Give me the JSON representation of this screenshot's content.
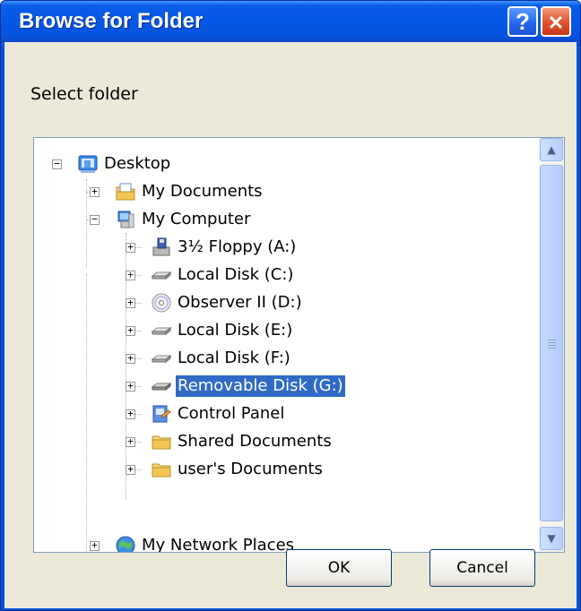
{
  "window": {
    "title": "Browse for Folder",
    "help_label": "?",
    "close_label": "✕"
  },
  "prompt": "Select folder",
  "tree": {
    "items": [
      {
        "label": "Desktop",
        "expander": "−",
        "icon": "desktop-icon"
      },
      {
        "label": "My Documents",
        "expander": "+",
        "icon": "my-documents-icon"
      },
      {
        "label": "My Computer",
        "expander": "−",
        "icon": "my-computer-icon"
      },
      {
        "label": "3½ Floppy (A:)",
        "expander": "+",
        "icon": "floppy-drive-icon"
      },
      {
        "label": "Local Disk (C:)",
        "expander": "+",
        "icon": "hard-disk-icon"
      },
      {
        "label": "Observer II (D:)",
        "expander": "+",
        "icon": "cd-drive-icon"
      },
      {
        "label": "Local Disk (E:)",
        "expander": "+",
        "icon": "hard-disk-icon"
      },
      {
        "label": "Local Disk (F:)",
        "expander": "+",
        "icon": "hard-disk-icon"
      },
      {
        "label": "Removable Disk (G:)",
        "expander": "+",
        "icon": "removable-disk-icon",
        "selected": true
      },
      {
        "label": "Control Panel",
        "expander": "+",
        "icon": "control-panel-icon"
      },
      {
        "label": "Shared Documents",
        "expander": "+",
        "icon": "folder-icon"
      },
      {
        "label": "user's Documents",
        "expander": "+",
        "icon": "folder-icon"
      },
      {
        "label": "My Network Places",
        "expander": "+",
        "icon": "network-places-icon"
      }
    ],
    "selection_color": "#316AC5"
  },
  "buttons": {
    "ok": "OK",
    "cancel": "Cancel"
  },
  "colors": {
    "titlebar": "#0558E6",
    "client": "#ECE9D8"
  }
}
